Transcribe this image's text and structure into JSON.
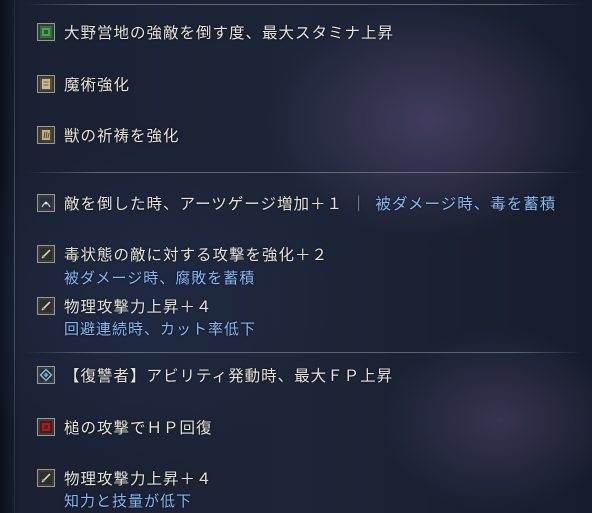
{
  "effects": {
    "group1": {
      "e1": {
        "icon": "green-gem-icon",
        "text": "大野営地の強敵を倒す度、最大スタミナ上昇"
      },
      "e2": {
        "icon": "sorcery-tome-icon",
        "text": "魔術強化"
      },
      "e3": {
        "icon": "beast-claw-icon",
        "text": "獣の祈祷を強化"
      }
    },
    "group2": {
      "e1": {
        "icon": "arts-gauge-icon",
        "text": "敵を倒した時、アーツゲージ増加＋１",
        "separator": "｜",
        "negative": "被ダメージ時、毒を蓄積"
      },
      "e2": {
        "icon": "sword-icon",
        "text": "毒状態の敵に対する攻撃を強化＋２",
        "negative": "被ダメージ時、腐敗を蓄積"
      },
      "e3": {
        "icon": "sword-icon",
        "text": "物理攻撃力上昇＋４",
        "negative": "回避連続時、カット率低下"
      }
    },
    "group3": {
      "e1": {
        "icon": "shield-diamond-icon",
        "text": "【復讐者】アビリティ発動時、最大ＦＰ上昇"
      },
      "e2": {
        "icon": "red-gem-icon",
        "text": "槌の攻撃でＨＰ回復"
      },
      "e3": {
        "icon": "sword-icon",
        "text": "物理攻撃力上昇＋４",
        "negative": "知力と技量が低下"
      }
    }
  },
  "colors": {
    "text": "#e6e4da",
    "negative": "#86b8f5",
    "divider": "#96a0aa"
  }
}
